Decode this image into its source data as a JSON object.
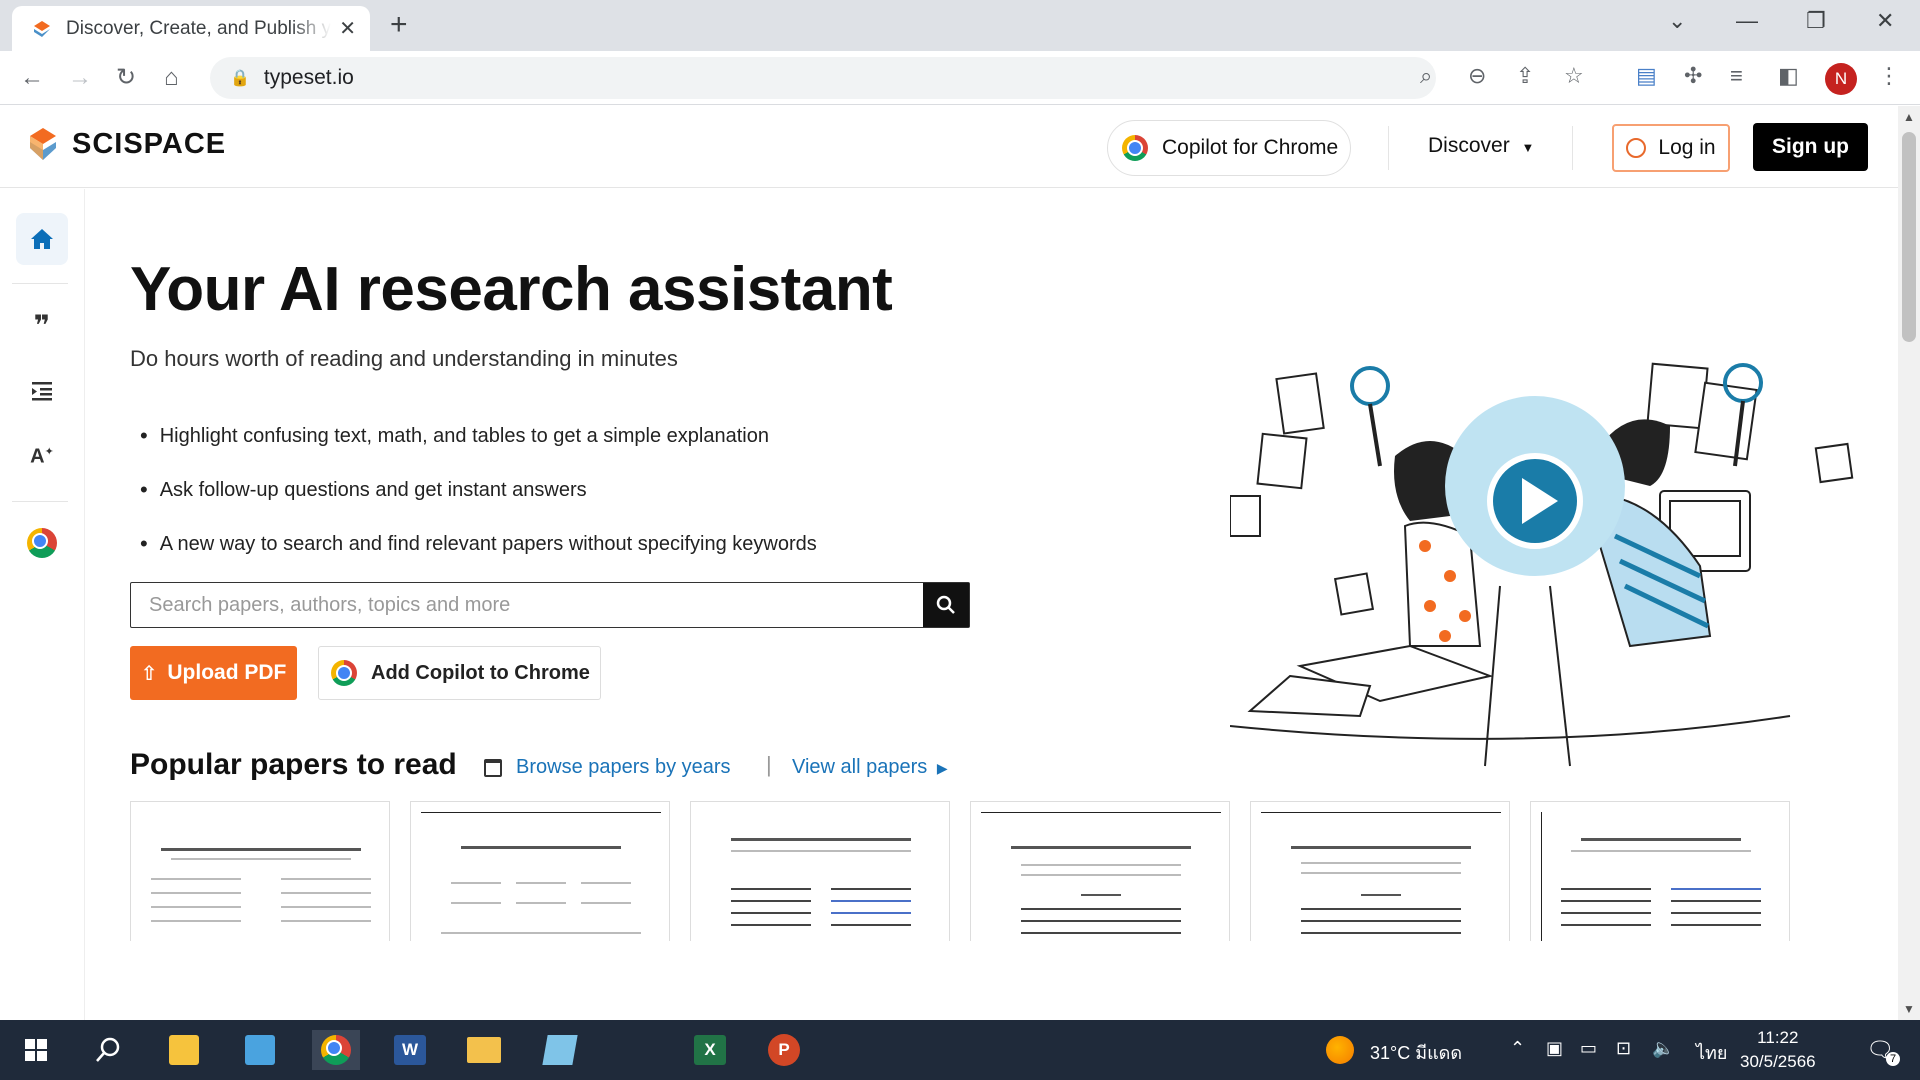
{
  "browser": {
    "tab_title": "Discover, Create, and Publish your research paper | SciSpace by Typeset",
    "url": "typeset.io",
    "profile_initial": "N"
  },
  "header": {
    "logo_text": "SCISPACE",
    "copilot_label": "Copilot for Chrome",
    "discover_label": "Discover",
    "login_label": "Log in",
    "signup_label": "Sign up"
  },
  "sidebar": {
    "items": [
      {
        "name": "home-icon",
        "glyph": "⌂",
        "active": true
      },
      {
        "name": "quote-icon",
        "glyph": "❞",
        "active": false
      },
      {
        "name": "list-indent-icon",
        "glyph": "☰",
        "active": false
      },
      {
        "name": "ai-text-icon",
        "glyph": "A*",
        "active": false
      }
    ]
  },
  "hero": {
    "title": "Your AI research assistant",
    "subtitle": "Do hours worth of reading and understanding in minutes",
    "bullets": [
      "Highlight confusing text, math, and tables to get a simple explanation",
      "Ask follow-up questions and get instant answers",
      "A new way to search and find relevant papers without specifying keywords"
    ],
    "search_placeholder": "Search papers, authors, topics and more",
    "upload_label": "Upload PDF",
    "add_copilot_label": "Add Copilot to Chrome"
  },
  "popular": {
    "title": "Popular papers to read",
    "browse_label": "Browse papers by years",
    "separator": "|",
    "view_all_label": "View all papers"
  },
  "taskbar": {
    "weather": "31°C มีแดด",
    "language": "ไทย",
    "time": "11:22",
    "date": "30/5/2566",
    "notification_count": "7"
  },
  "colors": {
    "accent_orange": "#f26b21",
    "link_blue": "#1a73b8",
    "play_blue": "#1a7ca8"
  }
}
